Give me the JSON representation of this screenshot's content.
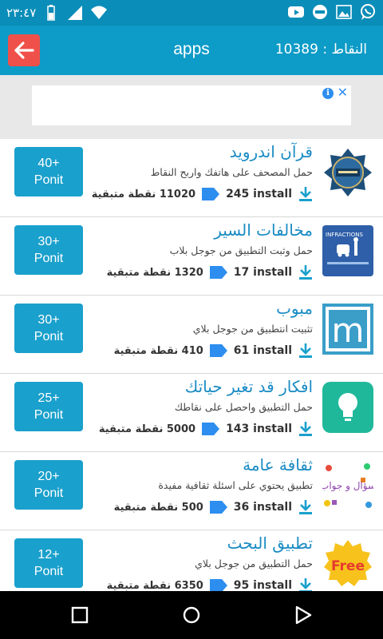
{
  "status_bar": {
    "time": "٢٣:٤٧",
    "icons": [
      "whatsapp-icon",
      "gallery-icon",
      "notification-app-icon",
      "youtube-icon",
      "wifi-icon",
      "signal-icon",
      "battery-icon"
    ]
  },
  "app_bar": {
    "title": "apps",
    "points_label": "النقاط : 10389",
    "back_color": "#f0504a",
    "bar_color": "#0d9bc7"
  },
  "ad": {
    "info_symbol": "i",
    "close_symbol": "✕"
  },
  "apps": [
    {
      "name": "قرآن اندرويد",
      "description": "حمل المصحف على هاتفك واربح النقاط",
      "installs": "245 install",
      "remaining": "11020 نقطة متبقية",
      "points_value": "40+",
      "points_unit": "Ponit",
      "thumb_icon": "quran-app-icon"
    },
    {
      "name": "مخالفات السير",
      "description": "حمل وثبت التطبيق من جوجل بلاب",
      "installs": "17 install",
      "remaining": "1320 نقطة متبقية",
      "points_value": "30+",
      "points_unit": "Ponit",
      "thumb_icon": "traffic-violations-app-icon",
      "thumb_text": "INFRACTIONS"
    },
    {
      "name": "مبوب",
      "description": "تثبيت انتطبيق من جوجل بلاي",
      "installs": "61 install",
      "remaining": "410 نقطة متبقية",
      "points_value": "30+",
      "points_unit": "Ponit",
      "thumb_icon": "mobawab-app-icon",
      "thumb_text": "m"
    },
    {
      "name": "افكار قد تغير حياتك",
      "description": "حمل التطبيق واحصل على نقاطك",
      "installs": "143 install",
      "remaining": "5000 نقطة متبقية",
      "points_value": "25+",
      "points_unit": "Ponit",
      "thumb_icon": "lightbulb-app-icon"
    },
    {
      "name": "ثقافة عامة",
      "description": "تطبيق يحتوي على اسئلة ثقافية مفيدة",
      "installs": "36 install",
      "remaining": "500 نقطة متبقية",
      "points_value": "20+",
      "points_unit": "Ponit",
      "thumb_icon": "question-answer-app-icon",
      "thumb_text": "سؤال و جواب"
    },
    {
      "name": "تطبيق البحث",
      "description": "حمل التطبيق من جوجل بلاي",
      "installs": "95 install",
      "remaining": "6350 نقطة متبقية",
      "points_value": "12+",
      "points_unit": "Ponit",
      "thumb_icon": "free-badge-icon",
      "thumb_text": "Free"
    }
  ],
  "nav_bar": {
    "buttons": [
      "recents-square-icon",
      "home-circle-icon",
      "back-triangle-icon"
    ]
  },
  "colors": {
    "accent": "#1aa0cc",
    "name_blue": "#1a8bc4",
    "tag_blue": "#2d8ef0"
  }
}
